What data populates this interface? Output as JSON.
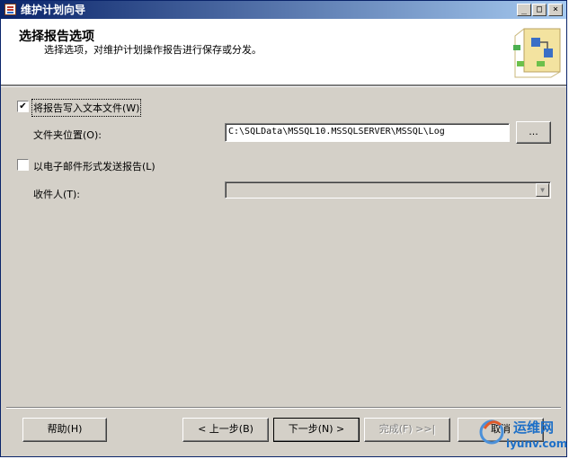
{
  "window": {
    "title": "维护计划向导",
    "controls": {
      "minimize": "_",
      "maximize": "□",
      "close": "×"
    }
  },
  "header": {
    "title": "选择报告选项",
    "subtitle": "选择选项，对维护计划操作报告进行保存或分发。",
    "icon": "wizard-graphic"
  },
  "options": {
    "write_text": {
      "label": "将报告写入文本文件(W)",
      "checked": "✔"
    },
    "folder_label": "文件夹位置(O):",
    "folder_value": "C:\\SQLData\\MSSQL10.MSSQLSERVER\\MSSQL\\Log",
    "browse_label": "...",
    "email": {
      "label": "以电子邮件形式发送报告(L)",
      "checked": ""
    },
    "recipient_label": "收件人(T):",
    "recipient_value": "",
    "dropdown_arrow": "▼"
  },
  "footer": {
    "help": "帮助(H)",
    "back": "< 上一步(B)",
    "next": "下一步(N) >",
    "finish": "完成(F) >>|",
    "cancel": "取消"
  },
  "watermark": {
    "name": "运维网",
    "url": "iyunv.com"
  }
}
